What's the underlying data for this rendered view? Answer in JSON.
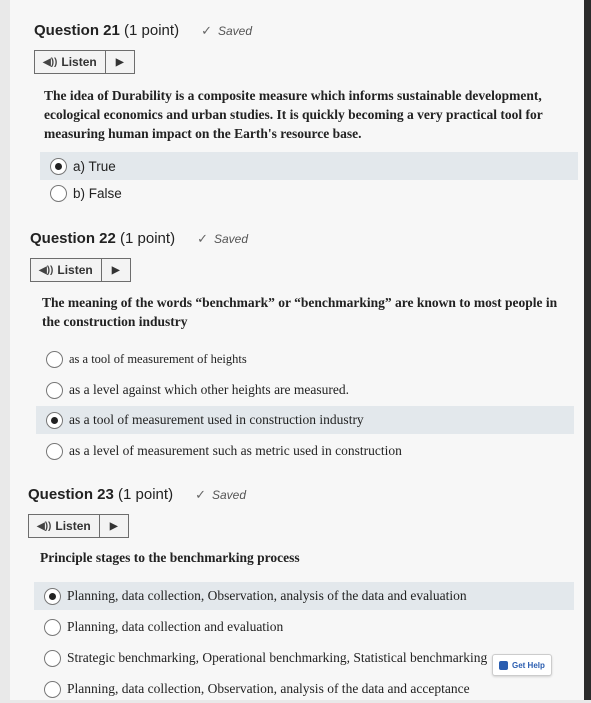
{
  "questions": [
    {
      "number": "Question 21",
      "points": "(1 point)",
      "saved": "Saved",
      "listen_label": "Listen",
      "text": "The idea of Durability is a composite measure which informs sustainable development, ecological economics and urban studies. It is quickly becoming a very practical tool for measuring human impact on the Earth's resource base.",
      "options": [
        "a) True",
        "b) False"
      ],
      "selected": 0
    },
    {
      "number": "Question 22",
      "points": "(1 point)",
      "saved": "Saved",
      "listen_label": "Listen",
      "text": "The meaning of the words “benchmark” or “benchmarking” are known to most people in the construction industry",
      "options": [
        "as a tool of measurement of heights",
        "as a level against which other heights are measured.",
        "as a tool of measurement used in construction industry",
        "as a level of measurement such as metric used in construction"
      ],
      "selected": 2
    },
    {
      "number": "Question 23",
      "points": "(1 point)",
      "saved": "Saved",
      "listen_label": "Listen",
      "text": "Principle stages to the benchmarking process",
      "options": [
        "Planning, data collection, Observation, analysis of the data and evaluation",
        "Planning, data collection and evaluation",
        "Strategic benchmarking, Operational benchmarking, Statistical benchmarking",
        "Planning, data collection, Observation, analysis of the data and acceptance"
      ],
      "selected": 0
    }
  ],
  "get_help_label": "Get Help",
  "icons": {
    "saved": "check-icon",
    "listen": "speaker-icon",
    "play": "play-icon"
  }
}
